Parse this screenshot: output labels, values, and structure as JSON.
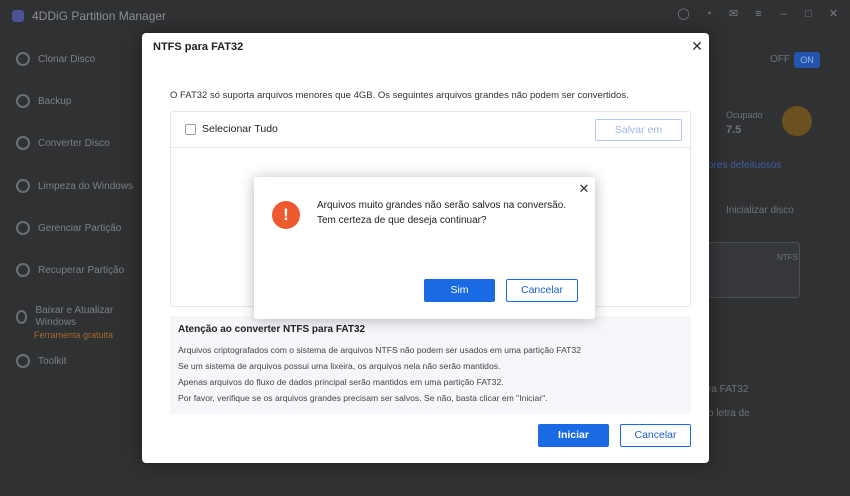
{
  "app": {
    "title": "4DDiG Partition Manager",
    "sidebar": [
      {
        "label": "Clonar Disco"
      },
      {
        "label": "Backup"
      },
      {
        "label": "Converter Disco"
      },
      {
        "label": "Limpeza do Windows"
      },
      {
        "label": "Gerenciar Partição"
      },
      {
        "label": "Recuperar Partição"
      },
      {
        "label": "Baixar e Atualizar Windows"
      },
      {
        "label": "Toolkit"
      }
    ],
    "promo": "Ferramenta gratuita",
    "right": {
      "toggle_off": "OFF",
      "toggle_on": "ON",
      "used_label": "Ocupado",
      "used_value": "7.5",
      "bad_sectors": "ores defeituosos",
      "init_disk": "Inicializar disco",
      "ntfs": "NTFS",
      "to_fat32": "ra FAT32",
      "delete_of": "o letra de"
    },
    "colors": {
      "accent": "#1a6ae3",
      "warning": "#ee5a2e"
    }
  },
  "dialog": {
    "title": "NTFS para FAT32",
    "description": "O FAT32 só suporta arquivos menores que 4GB. Os seguintes arquivos grandes não podem ser convertidos.",
    "select_all": "Selecionar Tudo",
    "save_to": "Salvar em",
    "note": {
      "title": "Atenção ao converter NTFS para FAT32",
      "lines": [
        "Arquivos criptografados com o sistema de arquivos NTFS não podem ser usados em uma partição FAT32",
        "Se um sistema de arquivos possui uma lixeira, os arquivos nela não serão mantidos.",
        "Apenas arquivos do fluxo de dados principal serão mantidos em uma partição FAT32.",
        "Por favor, verifique se os arquivos grandes precisam ser salvos. Se não, basta clicar em \"Iniciar\"."
      ]
    },
    "start": "Iniciar",
    "cancel": "Cancelar"
  },
  "confirm": {
    "line1": "Arquivos muito grandes não serão salvos na conversão.",
    "line2": "Tem certeza de que deseja continuar?",
    "yes": "Sim",
    "cancel": "Cancelar",
    "icon": "!"
  }
}
